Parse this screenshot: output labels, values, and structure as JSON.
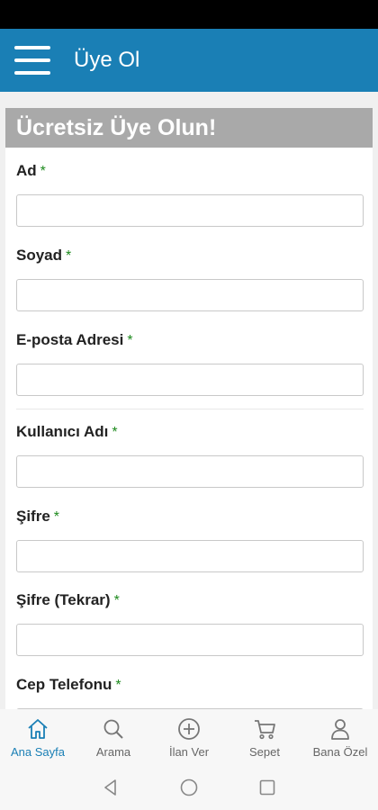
{
  "app_bar": {
    "title": "Üye Ol"
  },
  "card": {
    "header": "Ücretsiz Üye Olun!"
  },
  "form": {
    "required_mark": "*",
    "fields": [
      {
        "label": "Ad",
        "value": ""
      },
      {
        "label": "Soyad",
        "value": ""
      },
      {
        "label": "E-posta Adresi",
        "value": ""
      },
      {
        "label": "Kullanıcı Adı",
        "value": ""
      },
      {
        "label": "Şifre",
        "value": ""
      },
      {
        "label": "Şifre (Tekrar)",
        "value": ""
      },
      {
        "label": "Cep Telefonu",
        "value": ""
      }
    ]
  },
  "bottom_nav": {
    "items": [
      {
        "label": "Ana Sayfa",
        "icon": "home-icon",
        "active": true
      },
      {
        "label": "Arama",
        "icon": "search-icon",
        "active": false
      },
      {
        "label": "İlan Ver",
        "icon": "plus-circle-icon",
        "active": false
      },
      {
        "label": "Sepet",
        "icon": "cart-icon",
        "active": false
      },
      {
        "label": "Bana Özel",
        "icon": "user-icon",
        "active": false
      }
    ]
  },
  "colors": {
    "primary": "#1a7fb5",
    "required": "#1e8a1e",
    "header_bg": "#a9a9a9"
  }
}
